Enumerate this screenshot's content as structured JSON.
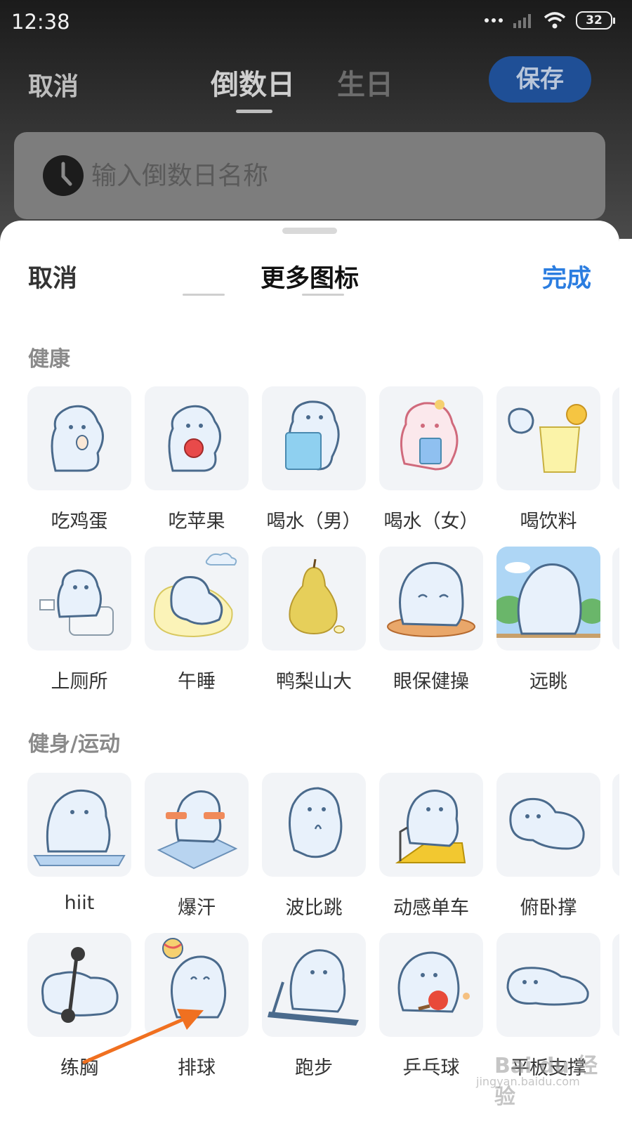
{
  "status_bar": {
    "time": "12:38",
    "battery": "32"
  },
  "top_nav": {
    "cancel": "取消",
    "tab_active": "倒数日",
    "tab_inactive": "生日",
    "save": "保存"
  },
  "name_input": {
    "placeholder": "输入倒数日名称"
  },
  "sheet": {
    "cancel": "取消",
    "title": "更多图标",
    "done": "完成",
    "sections": [
      {
        "title": "健康",
        "rows": [
          [
            "吃鸡蛋",
            "吃苹果",
            "喝水（男）",
            "喝水（女）",
            "喝饮料"
          ],
          [
            "上厕所",
            "午睡",
            "鸭梨山大",
            "眼保健操",
            "远眺"
          ]
        ]
      },
      {
        "title": "健身/运动",
        "rows": [
          [
            "hiit",
            "爆汗",
            "波比跳",
            "动感单车",
            "俯卧撑"
          ],
          [
            "练胸",
            "排球",
            "跑步",
            "乒乓球",
            "平板支撑"
          ]
        ]
      }
    ]
  },
  "watermark": {
    "text": "Bai du 经验",
    "sub": "jingyan.baidu.com"
  },
  "colors": {
    "accent": "#2b7de0",
    "save_button": "#1f4f96",
    "mascot": "#e8f1fb",
    "mascot_outline": "#4a6a8c",
    "arrow": "#f07020"
  }
}
